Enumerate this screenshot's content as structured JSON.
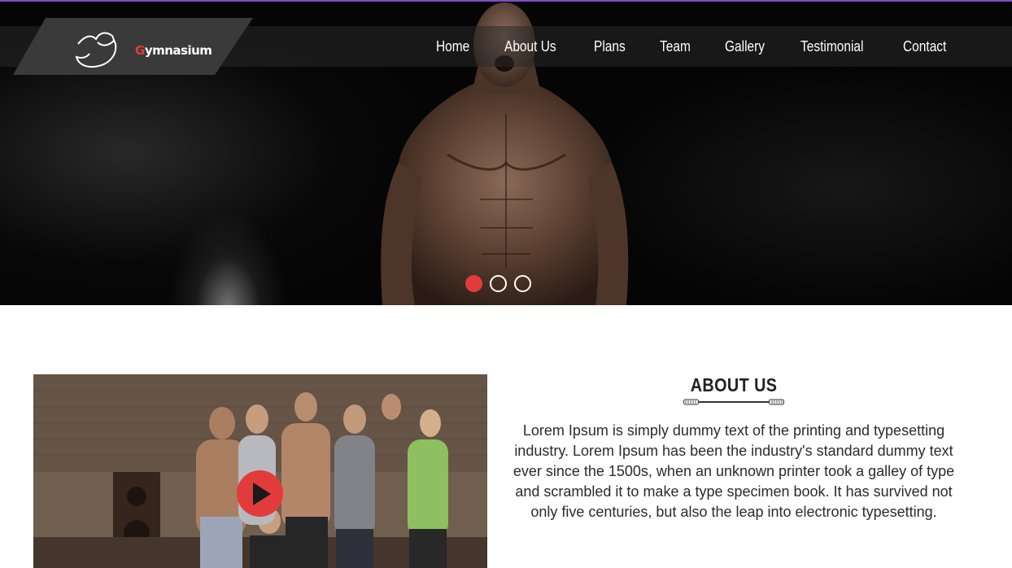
{
  "brand": {
    "logo_prefix": "G",
    "logo_rest": "ymnasium",
    "accent_color": "#e23b3b",
    "topline_color": "#7a4fc7"
  },
  "nav": {
    "items": [
      {
        "label": "Home"
      },
      {
        "label": "About Us"
      },
      {
        "label": "Plans"
      },
      {
        "label": "Team"
      },
      {
        "label": "Gallery"
      },
      {
        "label": "Testimonial"
      },
      {
        "label": "Contact"
      }
    ]
  },
  "slider": {
    "slide_count": 3,
    "active_index": 0
  },
  "about": {
    "title": "ABOUT US",
    "divider_icon": "dumbbell-rope-icon",
    "body": "Lorem Ipsum is simply dummy text of the printing and typesetting industry. Lorem Ipsum has been the industry's standard dummy text ever since the 1500s, when an unknown printer took a galley of type and scrambled it to make a type specimen book. It has survived not only five centuries, but also the leap into electronic typesetting."
  },
  "video": {
    "play_icon": "play-icon"
  }
}
